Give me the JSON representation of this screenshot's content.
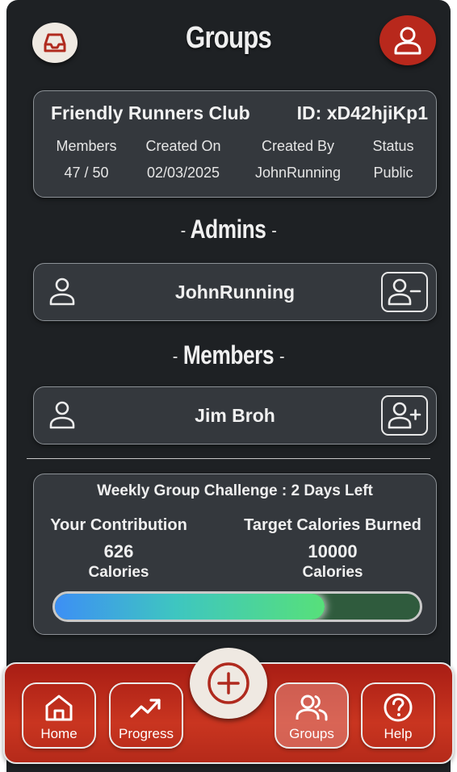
{
  "header": {
    "title": "Groups",
    "inbox_icon": "inbox-icon",
    "profile_icon": "user-icon"
  },
  "group": {
    "name": "Friendly Runners Club",
    "id_text": "ID: xD42hjiKp1",
    "stats": [
      {
        "label": "Members",
        "value": "47 / 50"
      },
      {
        "label": "Created On",
        "value": "02/03/2025"
      },
      {
        "label": "Created By",
        "value": "JohnRunning"
      },
      {
        "label": "Status",
        "value": "Public"
      }
    ]
  },
  "admins": {
    "dash_left": "-",
    "title": "Admins",
    "dash_right": "-",
    "items": [
      {
        "name": "JohnRunning",
        "action_icon": "remove-user-icon"
      }
    ]
  },
  "members": {
    "dash_left": "-",
    "title": "Members",
    "dash_right": "-",
    "items": [
      {
        "name": "Jim Broh",
        "action_icon": "add-user-icon"
      }
    ]
  },
  "challenge": {
    "title": "Weekly Group Challenge : 2 Days Left",
    "contribution_label": "Your Contribution",
    "contribution_value": "626",
    "contribution_unit": "Calories",
    "target_label": "Target Calories Burned",
    "target_value": "10000",
    "target_unit": "Calories",
    "progress_fraction": 0.74
  },
  "nav": {
    "items": [
      {
        "label": "Home",
        "icon": "home-icon"
      },
      {
        "label": "Progress",
        "icon": "trend-icon"
      },
      {
        "label": "Groups",
        "icon": "users-icon",
        "active": true
      },
      {
        "label": "Help",
        "icon": "help-icon"
      }
    ],
    "fab_icon": "plus-circle-icon"
  },
  "colors": {
    "background": "#1e2124",
    "card": "#34383d",
    "accent_red": "#b8281c",
    "cream": "#efe9e2"
  }
}
